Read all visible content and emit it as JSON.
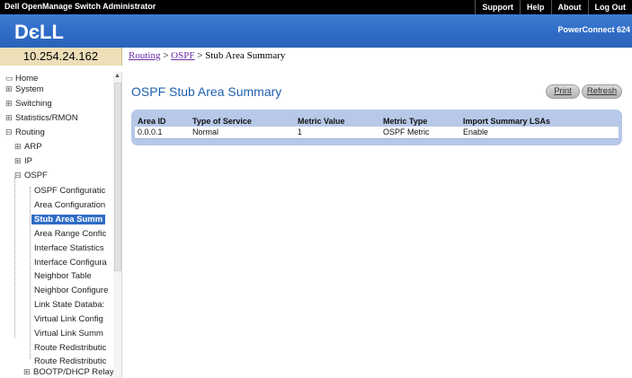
{
  "topbar": {
    "title": "Dell OpenManage Switch Administrator",
    "links": [
      "Support",
      "Help",
      "About",
      "Log Out"
    ]
  },
  "banner": {
    "logo_text": "DєLL",
    "product": "PowerConnect 624"
  },
  "device": {
    "ip": "10.254.24.162"
  },
  "breadcrumb": {
    "routing": "Routing",
    "ospf": "OSPF",
    "current": "Stub Area Summary"
  },
  "nav": {
    "items": [
      {
        "label": "Home",
        "prefix": "▭"
      },
      {
        "label": "System",
        "prefix": "⊞"
      },
      {
        "label": "Switching",
        "prefix": "⊞"
      },
      {
        "label": "Statistics/RMON",
        "prefix": "⊞"
      },
      {
        "label": "Routing",
        "prefix": "⊟"
      },
      {
        "label": "ARP",
        "prefix": "⊞"
      },
      {
        "label": "IP",
        "prefix": "⊞"
      },
      {
        "label": "OSPF",
        "prefix": "⊟"
      },
      {
        "label": "OSPF Configuratic"
      },
      {
        "label": "Area Configuration"
      },
      {
        "label": "Stub Area Summ"
      },
      {
        "label": "Area Range Confic"
      },
      {
        "label": "Interface Statistics"
      },
      {
        "label": "Interface Configura"
      },
      {
        "label": "Neighbor Table"
      },
      {
        "label": "Neighbor Configure"
      },
      {
        "label": "Link State Databa:"
      },
      {
        "label": "Virtual Link Config"
      },
      {
        "label": "Virtual Link Summ"
      },
      {
        "label": "Route Redistributic"
      },
      {
        "label": "Route Redistributic"
      },
      {
        "label": "BOOTP/DHCP Relay",
        "prefix": "⊞"
      }
    ]
  },
  "main": {
    "title": "OSPF Stub Area Summary",
    "print": "Print",
    "refresh": "Refresh",
    "table": {
      "headers": [
        "Area ID",
        "Type of Service",
        "Metric Value",
        "Metric Type",
        "Import Summary LSAs"
      ],
      "rows": [
        [
          "0.0.0.1",
          "Normal",
          "1",
          "OSPF Metric",
          "Enable"
        ]
      ]
    }
  },
  "colors": {
    "banner": "#2f6cc6",
    "ip_box": "#eedfb9",
    "title": "#1f5fae",
    "table_bg": "#b7c8e8"
  }
}
